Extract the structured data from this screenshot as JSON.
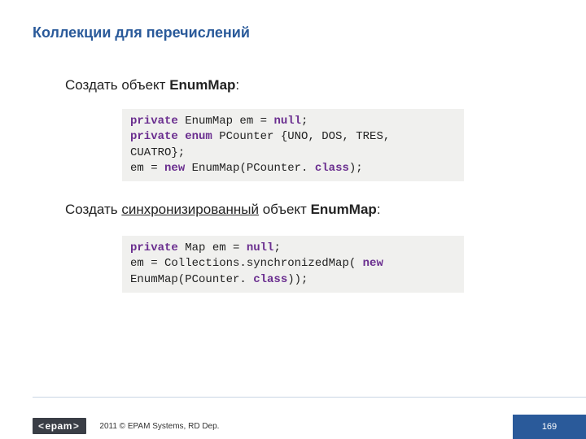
{
  "title": "Коллекции для перечислений",
  "subtitle1": {
    "pre": "Создать объект ",
    "bold": "EnumMap",
    "post": ":"
  },
  "subtitle2": {
    "pre": "Создать ",
    "underline": "синхронизированный",
    "mid": " объект ",
    "bold": "EnumMap",
    "post": ":"
  },
  "code1": {
    "l1": {
      "kw": "private",
      "rest": " EnumMap em = ",
      "nul": "null",
      "tail": ";"
    },
    "l2": {
      "kw1": "private",
      "sp1": " ",
      "kw2": "enum",
      "rest": " PCounter {UNO, DOS, TRES,"
    },
    "l3": "CUATRO};",
    "l4": {
      "pre": "em = ",
      "kw": "new",
      "mid": " EnumMap(PCounter.",
      "cls": " class",
      "tail": ");"
    }
  },
  "code2": {
    "l1": {
      "kw": "private",
      "rest": " Map em = ",
      "nul": "null",
      "tail": ";"
    },
    "l2": {
      "pre": "em = Collections.synchronizedMap(",
      "sp": " ",
      "kw": "new"
    },
    "l3": {
      "pre": "EnumMap(PCounter.",
      "cls": " class",
      "tail": "));"
    }
  },
  "footer": {
    "logo_text": "epam",
    "copyright": "2011 © EPAM Systems, RD Dep.",
    "page": "169"
  }
}
